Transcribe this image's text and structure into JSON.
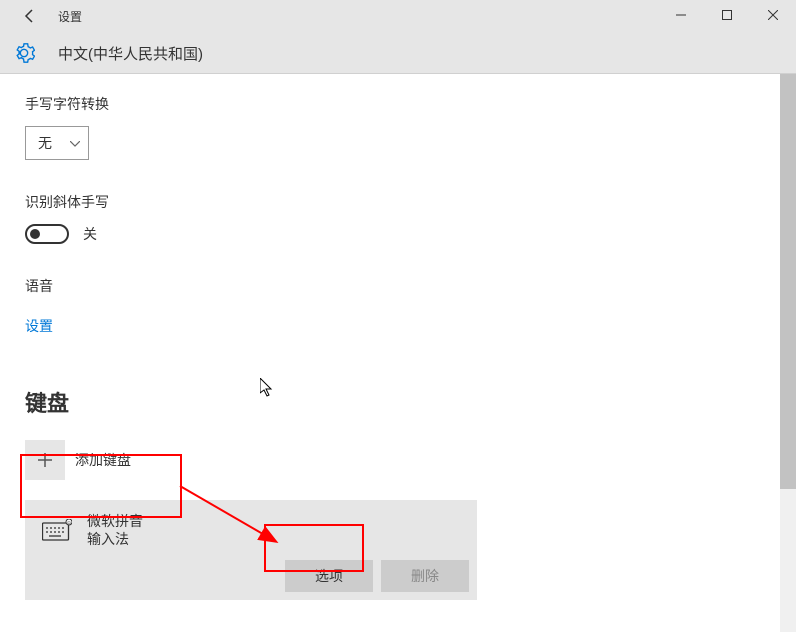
{
  "titlebar": {
    "title": "设置"
  },
  "page": {
    "heading": "中文(中华人民共和国)"
  },
  "handwriting": {
    "label": "手写字符转换",
    "dropdown_value": "无"
  },
  "slant": {
    "label": "识别斜体手写",
    "toggle_state": "关"
  },
  "speech": {
    "label": "语音",
    "link": "设置"
  },
  "keyboard": {
    "heading": "键盘",
    "add_label": "添加键盘",
    "items": [
      {
        "name": "微软拼音",
        "sub": "输入法",
        "options_label": "选项",
        "delete_label": "删除"
      }
    ]
  }
}
